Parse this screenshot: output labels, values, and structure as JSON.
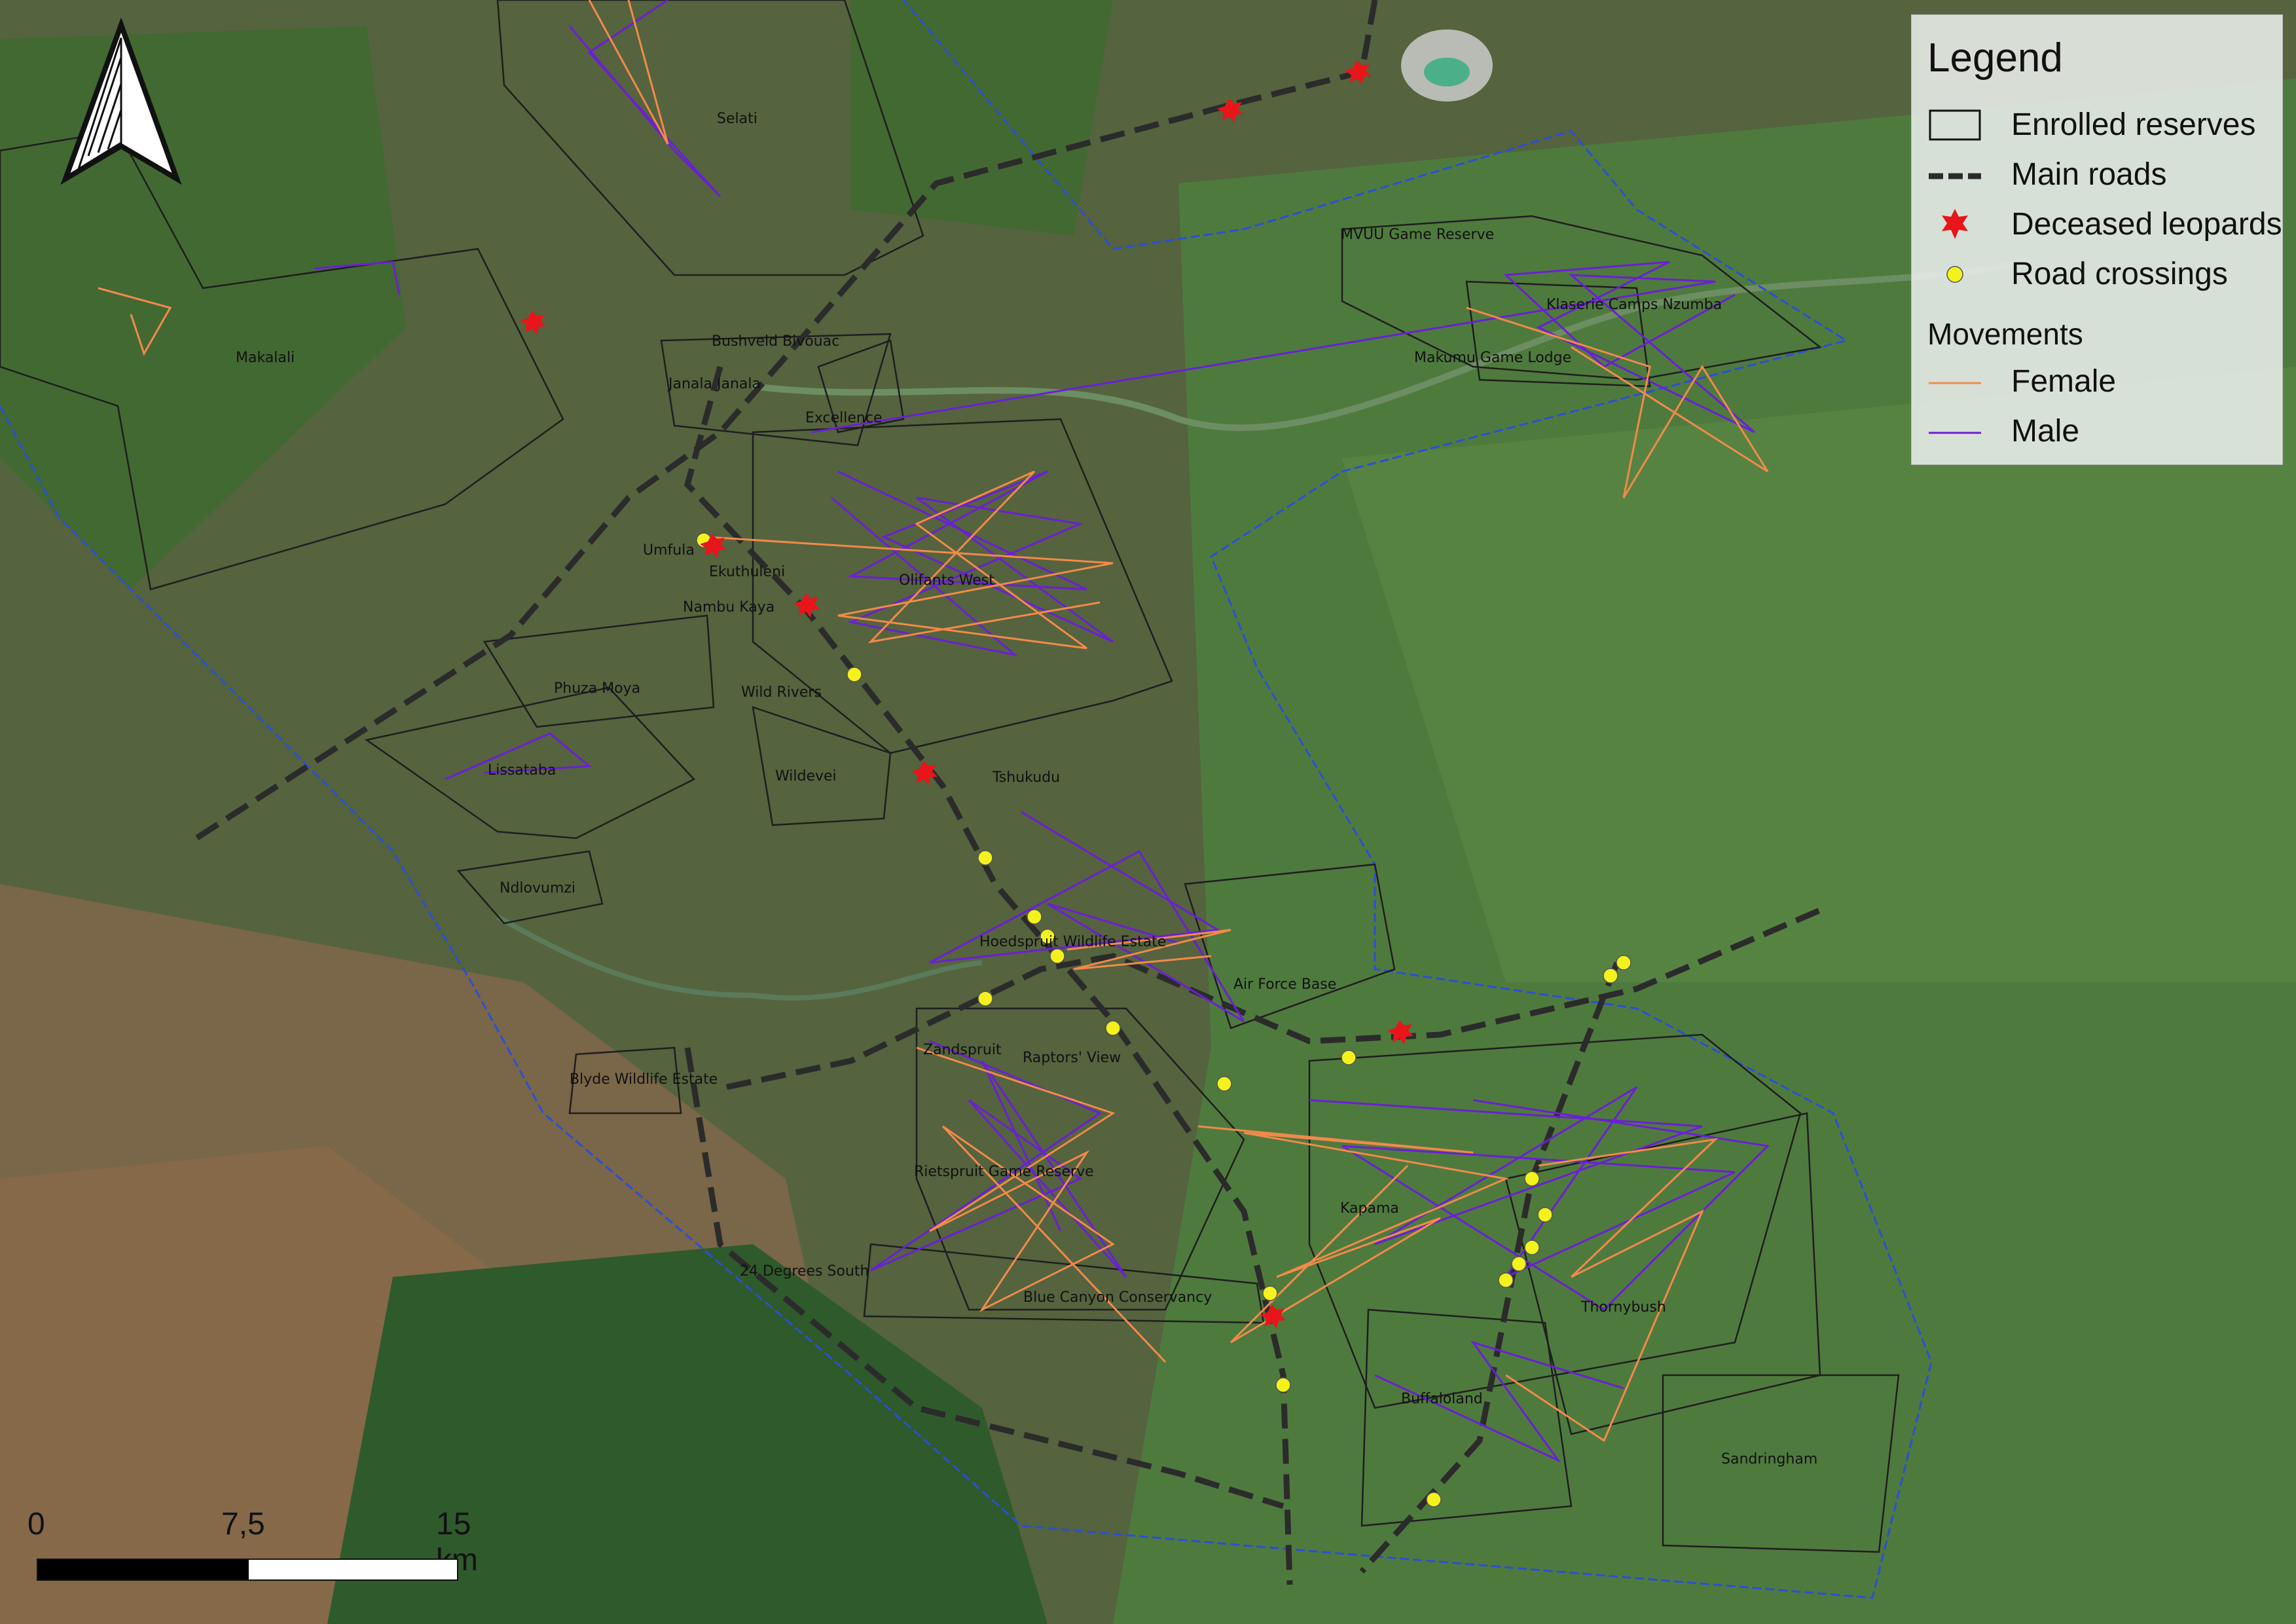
{
  "map": {
    "north_arrow": "north-arrow-icon",
    "reserves": [
      "Selati",
      "MVUU Game Reserve",
      "Klaserie Camps Nzumba",
      "Makumu Game Lodge",
      "Makalali",
      "Bushveld Bivouac",
      "Janala Janala",
      "Excellence",
      "Umfula",
      "Ekuthuleni",
      "Nambu Kaya",
      "Olifants West",
      "Wild Rivers",
      "Phuza Moya",
      "Lissataba",
      "Wildevei",
      "Tshukudu",
      "Ndlovumzi",
      "Hoedspruit Wildlife Estate",
      "Air Force Base",
      "Zandspruit",
      "Raptors' View",
      "Blyde Wildlife Estate",
      "Rietspruit Game Reserve",
      "Kapama",
      "24 Degrees South",
      "Blue Canyon Conservancy",
      "Thornybush",
      "Buffaloland",
      "Sandringham"
    ],
    "colors": {
      "female": "#f28a4a",
      "male": "#6b1fd6",
      "road": "#2b2b2b",
      "deceased": "#e8151b",
      "crossing": "#f4f21c",
      "boundary_blue": "#2a4fd6",
      "reserve_outline": "#1e1e1e"
    }
  },
  "legend": {
    "title": "Legend",
    "items": [
      {
        "label": "Enrolled reserves",
        "icon": "rectangle-outline-icon"
      },
      {
        "label": "Main roads",
        "icon": "dashed-line-icon"
      },
      {
        "label": "Deceased leopards",
        "icon": "red-star-icon"
      },
      {
        "label": "Road crossings",
        "icon": "yellow-dot-icon"
      }
    ],
    "movements_title": "Movements",
    "movements": [
      {
        "label": "Female",
        "icon": "orange-line-icon"
      },
      {
        "label": "Male",
        "icon": "purple-line-icon"
      }
    ]
  },
  "scale_bar": {
    "ticks": [
      "0",
      "7,5",
      "15 km"
    ]
  }
}
